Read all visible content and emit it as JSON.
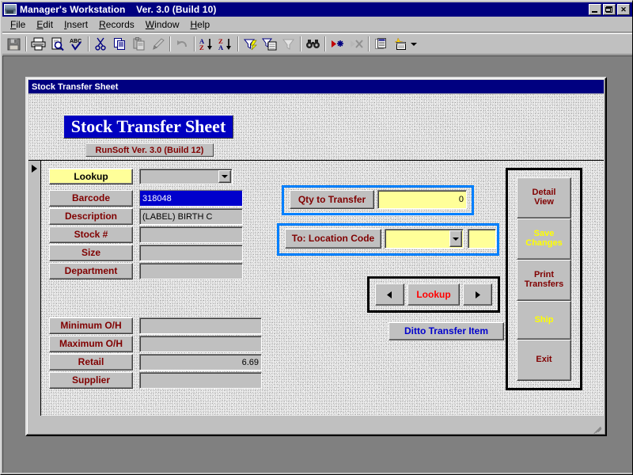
{
  "app": {
    "title": "Manager's Workstation    Ver. 3.0 (Build 10)",
    "window_buttons": {
      "minimize": "minimize-button",
      "restore": "restore-button",
      "close": "close-button"
    }
  },
  "menubar": {
    "items": [
      {
        "label": "File",
        "accel": "F"
      },
      {
        "label": "Edit",
        "accel": "E"
      },
      {
        "label": "Insert",
        "accel": "I"
      },
      {
        "label": "Records",
        "accel": "R"
      },
      {
        "label": "Window",
        "accel": "W"
      },
      {
        "label": "Help",
        "accel": "H"
      }
    ]
  },
  "toolbar": {
    "buttons": [
      {
        "name": "save-icon",
        "tip": "Save",
        "enabled": false
      },
      {
        "name": "print-icon",
        "tip": "Print",
        "enabled": true
      },
      {
        "name": "print-preview-icon",
        "tip": "Print Preview",
        "enabled": true
      },
      {
        "name": "spelling-icon",
        "tip": "Spelling",
        "enabled": true
      },
      {
        "name": "cut-icon",
        "tip": "Cut",
        "enabled": true
      },
      {
        "name": "copy-icon",
        "tip": "Copy",
        "enabled": true
      },
      {
        "name": "paste-icon",
        "tip": "Paste",
        "enabled": false
      },
      {
        "name": "format-painter-icon",
        "tip": "Format Painter",
        "enabled": false
      },
      {
        "name": "undo-icon",
        "tip": "Undo",
        "enabled": false
      },
      {
        "name": "sort-ascending-icon",
        "tip": "Sort Ascending",
        "enabled": true
      },
      {
        "name": "sort-descending-icon",
        "tip": "Sort Descending",
        "enabled": true
      },
      {
        "name": "filter-by-selection-icon",
        "tip": "Filter By Selection",
        "enabled": true
      },
      {
        "name": "filter-by-form-icon",
        "tip": "Filter By Form",
        "enabled": true
      },
      {
        "name": "apply-filter-icon",
        "tip": "Apply Filter",
        "enabled": false
      },
      {
        "name": "find-icon",
        "tip": "Find",
        "enabled": true
      },
      {
        "name": "new-record-icon",
        "tip": "New Record",
        "enabled": true
      },
      {
        "name": "delete-record-icon",
        "tip": "Delete Record",
        "enabled": false
      },
      {
        "name": "database-window-icon",
        "tip": "Database Window",
        "enabled": true
      },
      {
        "name": "new-object-icon",
        "tip": "New Object",
        "enabled": true
      }
    ]
  },
  "child_window": {
    "title": "Stock Transfer Sheet"
  },
  "form": {
    "header": {
      "title": "Stock Transfer Sheet",
      "subtitle": "RunSoft Ver. 3.0 (Build 12)"
    },
    "lookup_row": {
      "button_label": "Lookup",
      "combo_value": "",
      "combo_placeholder": ""
    },
    "item_fields": [
      {
        "label": "Barcode",
        "value": "318048",
        "selected": true
      },
      {
        "label": "Description",
        "value": "(LABEL) BIRTH C",
        "selected": false
      },
      {
        "label": "Stock #",
        "value": "",
        "selected": false
      },
      {
        "label": "Size",
        "value": "",
        "selected": false
      },
      {
        "label": "Department",
        "value": "",
        "selected": false
      }
    ],
    "stock_fields": [
      {
        "label": "Minimum O/H",
        "value": "",
        "align": "left"
      },
      {
        "label": "Maximum O/H",
        "value": "",
        "align": "left"
      },
      {
        "label": "Retail",
        "value": "6.69",
        "align": "right"
      },
      {
        "label": "Supplier",
        "value": "",
        "align": "left"
      }
    ],
    "transfer": {
      "qty_label": "Qty to Transfer",
      "qty_value": "0",
      "location_label": "To: Location Code",
      "location_combo_value": "",
      "location_extra_value": ""
    },
    "nav": {
      "prev_icon": "left-arrow-icon",
      "lookup_label": "Lookup",
      "next_icon": "right-arrow-icon",
      "ditto_label": "Ditto Transfer Item"
    },
    "actions": [
      {
        "label": "Detail\nView",
        "color": "#800000"
      },
      {
        "label": "Save\nChanges",
        "color": "#ffff00"
      },
      {
        "label": "Print\nTransfers",
        "color": "#800000"
      },
      {
        "label": "Ship",
        "color": "#ffff00"
      },
      {
        "label": "Exit",
        "color": "#800000"
      }
    ]
  },
  "colors": {
    "titlebar_blue": "#000080",
    "header_blue": "#0000c0",
    "accent_blue_border": "#0080ff",
    "label_dark_red": "#800000",
    "yellow_field": "#ffff99",
    "face_gray": "#c0c0c0",
    "nav_red": "#ff0000",
    "ditto_blue": "#0000cc"
  }
}
